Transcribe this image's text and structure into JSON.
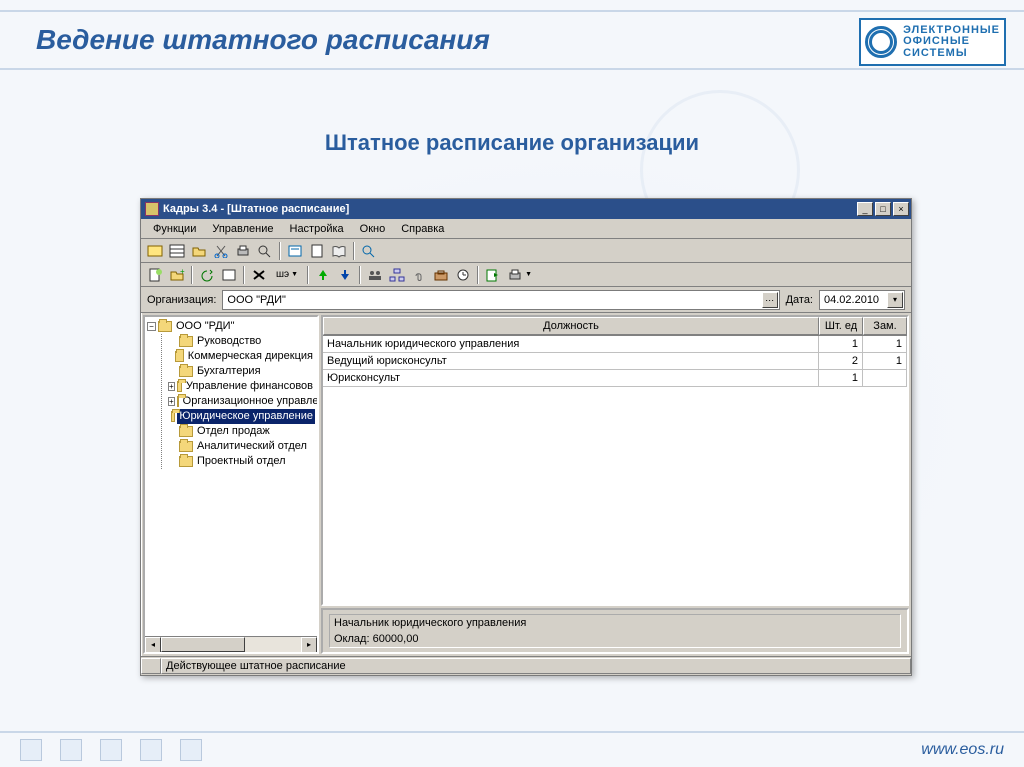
{
  "slide": {
    "title": "Ведение штатного расписания",
    "subtitle": "Штатное расписание организации",
    "footer_url": "www.eos.ru",
    "logo_lines": [
      "ЭЛЕКТРОННЫЕ",
      "ОФИСНЫЕ",
      "СИСТЕМЫ"
    ]
  },
  "app": {
    "window_title": "Кадры 3.4 - [Штатное расписание]",
    "menu": [
      "Функции",
      "Управление",
      "Настройка",
      "Окно",
      "Справка"
    ],
    "toolbar2_text_btn": "шэ",
    "filter": {
      "org_label": "Организация:",
      "org_value": "ООО \"РДИ\"",
      "date_label": "Дата:",
      "date_value": "04.02.2010"
    },
    "tree": {
      "root": "ООО \"РДИ\"",
      "children": [
        {
          "label": "Руководство",
          "expandable": false
        },
        {
          "label": "Коммерческая дирекция",
          "expandable": false
        },
        {
          "label": "Бухгалтерия",
          "expandable": false
        },
        {
          "label": "Управление финансовов",
          "expandable": true
        },
        {
          "label": "Организационное управле",
          "expandable": true
        },
        {
          "label": "Юридическое управление",
          "expandable": false,
          "selected": true
        },
        {
          "label": "Отдел продаж",
          "expandable": false
        },
        {
          "label": "Аналитический отдел",
          "expandable": false
        },
        {
          "label": "Проектный отдел",
          "expandable": false
        }
      ]
    },
    "grid": {
      "headers": {
        "position": "Должность",
        "units": "Шт. ед",
        "subst": "Зам."
      },
      "rows": [
        {
          "position": "Начальник юридического управления",
          "units": "1",
          "subst": "1"
        },
        {
          "position": "Ведущий юрисконсульт",
          "units": "2",
          "subst": "1"
        },
        {
          "position": "Юрисконсульт",
          "units": "1",
          "subst": ""
        }
      ]
    },
    "detail": {
      "position": "Начальник юридического управления",
      "salary_label": "Оклад:",
      "salary_value": "60000,00"
    },
    "statusbar": "Действующее штатное расписание"
  }
}
